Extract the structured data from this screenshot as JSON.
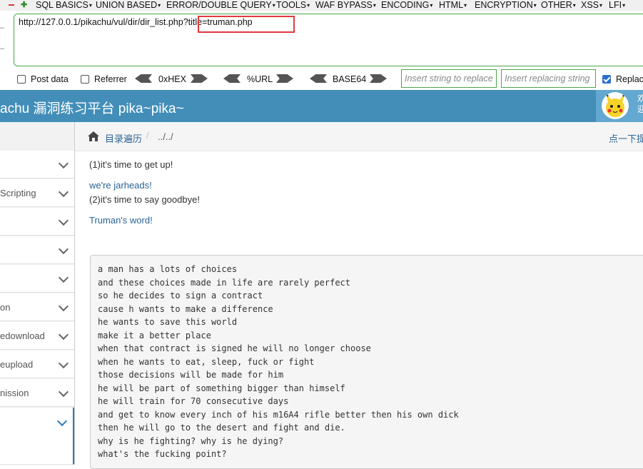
{
  "hackbar": {
    "menu": [
      "SQL BASICS",
      "UNION BASED",
      "ERROR/DOUBLE QUERY",
      "TOOLS",
      "WAF BYPASS",
      "ENCODING",
      "HTML",
      "ENCRYPTION",
      "OTHER",
      "XSS",
      "LFI"
    ],
    "url": "http://127.0.0.1/pikachu/vul/dir/dir_list.php?title=truman.php",
    "post_data": "Post data",
    "referrer": "Referrer",
    "hex": "0xHEX",
    "url_enc": "%URL",
    "base64": "BASE64",
    "insert_string": "Insert string to replace",
    "insert_replacing": "Insert replacing string",
    "replace_all": "Replace All"
  },
  "header": {
    "title": "achu 漏洞练习平台 pika~pika~",
    "welcome": "欢\n迎"
  },
  "sidebar": {
    "items": [
      "",
      "Scripting",
      "",
      "",
      "",
      "on",
      "edownload",
      "eupload",
      "nission",
      ""
    ]
  },
  "breadcrumb": {
    "home": "目录遍历",
    "sep": "/",
    "current": "../../",
    "tip": "点一下提示~"
  },
  "content": {
    "line1": "(1)it's time to get up!",
    "link1": "we're jarheads!",
    "line2": "(2)it's time to say goodbye!",
    "link2": "Truman's word!",
    "poem": [
      "a man has a lots of choices",
      "and these choices made in life are rarely perfect",
      "so he decides to sign a contract",
      "cause h wants to make a difference",
      "he wants to save this world",
      "make it a better place",
      "when that contract is signed he will no longer choose",
      "when he wants to eat, sleep, fuck or fight",
      "those decisions will be made for him",
      "he will be part of something bigger than himself",
      "he will train for 70 consecutive days",
      "and get to know every inch of his m16A4 rifle better then his own dick",
      "then he will go to the desert and fight and die.",
      "why is he fighting? why is he dying?",
      "what's the fucking point?"
    ]
  },
  "colors": {
    "header_bg": "#438eb9",
    "link": "#2a6496",
    "highlight_box": "#e0393e",
    "hackbar_border": "#4aa64a"
  }
}
